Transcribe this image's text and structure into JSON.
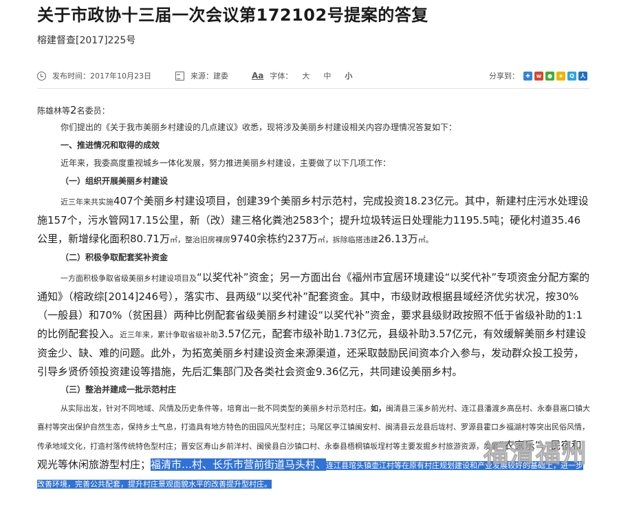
{
  "title": "关于市政协十三届一次会议第172102号提案的答复",
  "doc_number": "榕建督查[2017]225号",
  "meta": {
    "publish_time": "发布时间：2017年10月23日",
    "source": "来源：建委",
    "font_size_label": "字体：",
    "font_sizes": [
      "大",
      "中",
      "小"
    ],
    "share_label": "分享到："
  },
  "share_icons": [
    "qq-space-icon",
    "tencent-weibo-icon",
    "wechat-icon",
    "star-icon",
    "qq-icon",
    "renren-icon"
  ],
  "body": {
    "greeting_a": "陈雄林等",
    "greeting_b": "2",
    "greeting_c": "名委员：",
    "intro": "你们提出的《关于我市美丽乡村建设的几点建议》收悉，现将涉及美丽乡村建设相关内容办理情况答复如下：",
    "section1": "一、推进情况和取得的成效",
    "section1_intro": "近年来，我委高度重视城乡一体化发展，努力推进美丽乡村建设，主要做了以下几项工作：",
    "sub1": "（一）组织开展美丽乡村建设",
    "sub1_p_a": "近三年来共实施",
    "sub1_p_b": "407个美丽乡村建设项目，创建39个美丽乡村示范村，完成投资18.23亿元。其中，新建村庄污水处理设施157个，污水管网17.15公里，新（改）建三格化粪池2583个；提升垃圾转运日处理能力1195.5吨；硬化村道35.46公里，新增绿化面积80.71万",
    "sub1_p_c": "㎡，整治旧房裸房",
    "sub1_p_d": "9740余栋约237万",
    "sub1_p_e": "㎡，拆除临搭违建",
    "sub1_p_f": "26.13万",
    "sub1_p_g": "㎡。",
    "sub2": "（二）积极争取配套奖补资金",
    "sub2_p_a": "一方面积极争取省级美丽乡村建设项目及",
    "sub2_p_b": "“以奖代补”资金；另一方面出台《福州市宜居环境建设“以奖代补”专项资金分配方案的通知》（榕政综[2014]246号），落实市、县两级“以奖代补”配套资金。其中，市级财政根据县域经济优劣状况，按30%（一般县）和70%（贫困县）两种比例配套省级美丽乡村建设“以奖代补”资金，要求县级财政按照不低于省级补助的1:1的比例配套投入。",
    "sub2_p_c": "近三年来，累计争取省级补助",
    "sub2_p_d": "3.57亿元，配套市级补助1.73亿元，县级补助3.57亿元，有效缓解美丽乡村建设资金少、缺、难的问题。此外，为拓宽美丽乡村建设资金来源渠道，还采取鼓励民间资本介入参与，发动群众投工投劳，引导乡贤侨领投资建设等措施，先后汇集部门及各类社会资金9.36亿元，共同建设美丽乡村。",
    "sub3": "（三）整治并建成一批示范村庄",
    "sub3_p_a": "从实际出发，针对不同地域、风情及历史条件等，培育出一批不同类型的美丽乡村示范村庄。",
    "sub3_p_b": "如，",
    "sub3_p_c": "闽清县三溪乡前光村、连江县潘渡乡高岳村、永泰县嵩口镇大喜村等突出保护自然生态，保持乡土气息，打造具有地方特色的田园风光型村庄；马尾区亭江镇闽安村、闽清县云龙县后垅村、罗源县霍口乡福湖村等突出民俗风情，传承地域文化，打造村落传统特色型村庄；晋安区寿山乡前洋村、闽侯县白沙镇口村、永泰县梧桐镇坂埕村等主要发掘乡村旅游资源，发展",
    "sub3_p_d": "“农家乐”、民宿和观光等休闲旅游型村庄；",
    "sub3_p_hl1": "福清市…",
    "sub3_p_hl2": "村、长乐市营前街道马头村、",
    "sub3_p_hl3": "连江县琯头镇壶江村等在原有村庄规划建设和产业发展较好的基础上，进一步改善环境，完善公共配套，提升村庄景观面貌水平的改善提升型村庄。"
  },
  "watermark": "福清福州"
}
